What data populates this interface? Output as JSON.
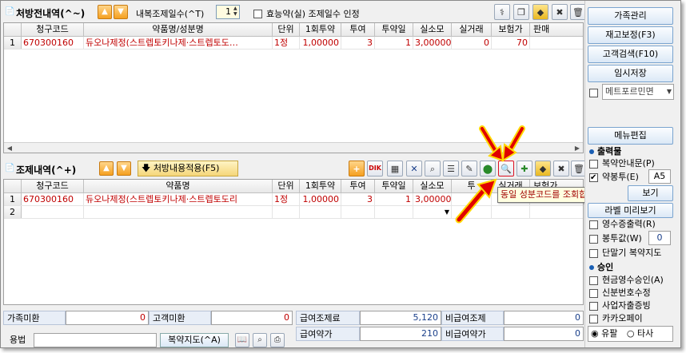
{
  "top_panel": {
    "title": "처방전내역(^~)",
    "repeat_label": "내복조제일수(^T)",
    "repeat_value": "1",
    "effective_days_label": "효능약(실) 조제일수 인정",
    "columns": [
      "청구코드",
      "약품명/성분명",
      "단위",
      "1회투약",
      "투여",
      "투약일",
      "실소모",
      "실거래",
      "보험가",
      "판매"
    ],
    "rows": [
      {
        "idx": "1",
        "code": "670300160",
        "name": "듀오나제정(스트렙토키나제·스트렙토도…",
        "unit": "1정",
        "dose": "1,00000",
        "times": "3",
        "days": "1",
        "usage": "3,00000",
        "actual": "0",
        "price": "70",
        "sale": ""
      }
    ]
  },
  "bottom_panel": {
    "title": "조제내역(^+)",
    "apply_button": "처방내용적용(F5)",
    "columns": [
      "청구코드",
      "약품명",
      "단위",
      "1회투약",
      "투여",
      "투약일",
      "실소모",
      "투",
      "실거래",
      "보험가"
    ],
    "rows": [
      {
        "idx": "1",
        "code": "670300160",
        "name": "듀오나제정(스트렙토키나제·스트렙토도리",
        "unit": "1정",
        "dose": "1,00000",
        "times": "3",
        "days": "1",
        "usage": "3,00000"
      },
      {
        "idx": "2",
        "code": "",
        "name": "",
        "unit": "",
        "dose": "",
        "times": "",
        "days": "",
        "usage": ""
      }
    ],
    "tooltip": "동일 성분코드를 조회합니다."
  },
  "summary": {
    "family_unpaid_label": "가족미환",
    "family_unpaid_value": "0",
    "customer_unpaid_label": "고객미환",
    "customer_unpaid_value": "0",
    "dispense_fee_label": "급여조제료",
    "dispense_fee_value": "5,120",
    "nonpay_fee_label": "비급여조제",
    "nonpay_fee_value": "0",
    "drug_cost_label": "급여약가",
    "drug_cost_value": "210",
    "nonpay_drug_label": "비급여약가",
    "nonpay_drug_value": "0",
    "usage_label": "용법",
    "guide_button": "복약지도(^A)"
  },
  "right_panel": {
    "family_button": "가족관리",
    "stock_button": "재고보정(F3)",
    "customer_button": "고객검색(F10)",
    "temp_save_button": "임시저장",
    "metformin_label": "메트포르민면",
    "menu_edit_button": "메뉴편집",
    "output_title": "출력물",
    "guide_check": "복약안내문(P)",
    "bag_check": "약봉투(E)",
    "bag_size": "A5",
    "preview_button": "보기",
    "label_preview_button": "라벨 미리보기",
    "receipt_check": "영수증출력(R)",
    "bag_value_check": "봉투값(W)",
    "bag_value": "0",
    "single_check": "단말기 복약지도",
    "approval_title": "승인",
    "cash_receipt_check": "현금영수승인(A)",
    "id_change_check": "신분번호수정",
    "business_check": "사업자출증빙",
    "kakao_check": "카카오페이",
    "radio_yupal": "유팔",
    "radio_other": "타사"
  }
}
